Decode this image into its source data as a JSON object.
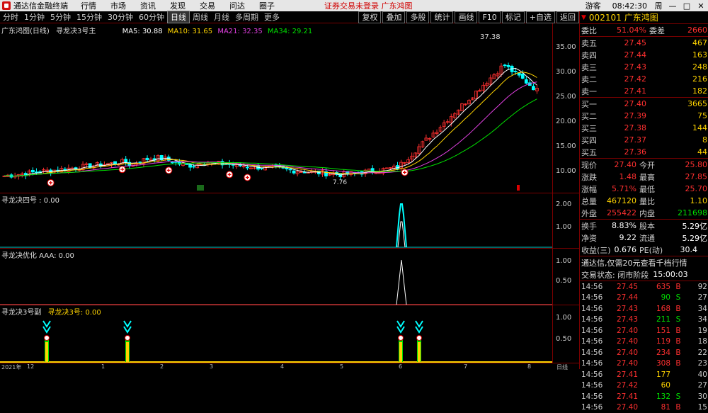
{
  "menubar": {
    "app": "通达信金融终端",
    "items": [
      "行情",
      "市场",
      "资讯",
      "发现",
      "交易",
      "问达",
      "圈子"
    ],
    "notice": "证券交易未登录  广东鸿图",
    "right": [
      "游客"
    ],
    "clock": "08:42:30",
    "win": [
      "周",
      "—",
      "□",
      "✕"
    ]
  },
  "periods": [
    "分时",
    "1分钟",
    "5分钟",
    "15分钟",
    "30分钟",
    "60分钟",
    "日线",
    "周线",
    "月线",
    "多周期",
    "更多"
  ],
  "period_active": "日线",
  "tools": [
    "复权",
    "叠加",
    "多股",
    "统计",
    "画线",
    "F10",
    "标记",
    "+自选",
    "返回"
  ],
  "kpanel": {
    "title": "广东鸿图(日线)",
    "chip": "寻龙决3号主",
    "ma": [
      {
        "label": "MA5: 30.88",
        "color": "#ffffff"
      },
      {
        "label": "MA10: 31.65",
        "color": "#ffd400"
      },
      {
        "label": "MA21: 32.35",
        "color": "#e040e0"
      },
      {
        "label": "MA34: 29.21",
        "color": "#00e000"
      }
    ],
    "high_label": "37.38",
    "low_label": "7.76",
    "yticks": [
      "35.00",
      "30.00",
      "25.00",
      "20.00",
      "15.00",
      "10.00"
    ]
  },
  "p2": {
    "title": "寻龙决四号 : 0.00",
    "yticks": [
      "2.00",
      "1.00"
    ]
  },
  "p3": {
    "title": "寻龙决优化 AAA: 0.00",
    "yticks": [
      "1.00",
      "0.50"
    ]
  },
  "p4": {
    "title": "寻龙决3号副",
    "title2": "寻龙决3号: 0.00",
    "yticks": [
      "1.00",
      "0.50"
    ]
  },
  "xaxis": [
    "2021年",
    "12",
    "1",
    "2",
    "3",
    "4",
    "5",
    "6",
    "7",
    "8"
  ],
  "bottom_tab": "日线",
  "right": {
    "code": "002101",
    "name": "广东鸿图",
    "wb": {
      "l": "委比",
      "v": "51.04%",
      "l2": "委差",
      "v2": "2660"
    },
    "asks": [
      {
        "l": "卖五",
        "p": "27.45",
        "n": "467"
      },
      {
        "l": "卖四",
        "p": "27.44",
        "n": "163"
      },
      {
        "l": "卖三",
        "p": "27.43",
        "n": "248"
      },
      {
        "l": "卖二",
        "p": "27.42",
        "n": "216"
      },
      {
        "l": "卖一",
        "p": "27.41",
        "n": "182"
      }
    ],
    "bids": [
      {
        "l": "买一",
        "p": "27.40",
        "n": "3665"
      },
      {
        "l": "买二",
        "p": "27.39",
        "n": "75"
      },
      {
        "l": "买三",
        "p": "27.38",
        "n": "144"
      },
      {
        "l": "买四",
        "p": "27.37",
        "n": "8"
      },
      {
        "l": "买五",
        "p": "27.36",
        "n": "44"
      }
    ],
    "stats": [
      {
        "l": "现价",
        "v": "27.40",
        "l2": "今开",
        "v2": "25.80"
      },
      {
        "l": "涨跌",
        "v": "1.48",
        "l2": "最高",
        "v2": "27.85"
      },
      {
        "l": "涨幅",
        "v": "5.71%",
        "l2": "最低",
        "v2": "25.70"
      },
      {
        "l": "总量",
        "v": "467120",
        "l2": "量比",
        "v2": "1.10"
      },
      {
        "l": "外盘",
        "v": "255422",
        "l2": "内盘",
        "v2": "211698"
      }
    ],
    "stats2": [
      {
        "l": "换手",
        "v": "8.83%",
        "l2": "股本",
        "v2": "5.29亿"
      },
      {
        "l": "净资",
        "v": "9.22",
        "l2": "流通",
        "v2": "5.29亿"
      },
      {
        "l": "收益(三)",
        "v": "0.676",
        "l2": "PE(动)",
        "v2": "30.4"
      }
    ],
    "promo": "通达信,仅需20元查看千档行情",
    "status": "交易状态: 闭市阶段",
    "status_time": "15:00:03",
    "ticks": [
      {
        "t": "14:56",
        "p": "27.45",
        "v": "635",
        "b": "B",
        "c": "92"
      },
      {
        "t": "14:56",
        "p": "27.44",
        "v": "90",
        "b": "S",
        "c": "27"
      },
      {
        "t": "14:56",
        "p": "27.43",
        "v": "168",
        "b": "B",
        "c": "34"
      },
      {
        "t": "14:56",
        "p": "27.43",
        "v": "211",
        "b": "S",
        "c": "34"
      },
      {
        "t": "14:56",
        "p": "27.40",
        "v": "151",
        "b": "B",
        "c": "19"
      },
      {
        "t": "14:56",
        "p": "27.40",
        "v": "119",
        "b": "B",
        "c": "18"
      },
      {
        "t": "14:56",
        "p": "27.40",
        "v": "234",
        "b": "B",
        "c": "22"
      },
      {
        "t": "14:56",
        "p": "27.40",
        "v": "308",
        "b": "B",
        "c": "23"
      },
      {
        "t": "14:56",
        "p": "27.41",
        "v": "177",
        "b": "",
        "c": "40"
      },
      {
        "t": "14:56",
        "p": "27.42",
        "v": "60",
        "b": "",
        "c": "27"
      },
      {
        "t": "14:56",
        "p": "27.41",
        "v": "132",
        "b": "S",
        "c": "30"
      },
      {
        "t": "14:56",
        "p": "27.40",
        "v": "81",
        "b": "B",
        "c": "15"
      }
    ]
  },
  "colors": {
    "up": "#ff3030",
    "down": "#00ffff",
    "ma5": "#ffffff",
    "ma10": "#ffd400",
    "ma21": "#e040e0",
    "ma34": "#00e000",
    "border": "#7a0000"
  }
}
